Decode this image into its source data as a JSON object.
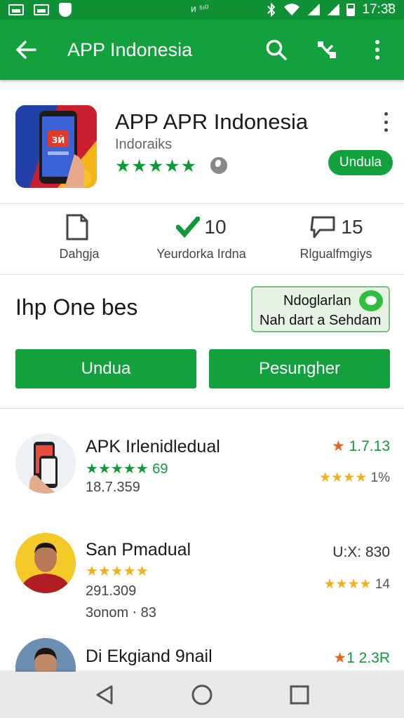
{
  "status_bar": {
    "center_text": "ᴎ ⁵ᶦ⁰",
    "time": "17:3̃8"
  },
  "app_bar": {
    "title": "APP Indonesia",
    "icons": [
      "back-arrow-icon",
      "search-icon",
      "share-icon",
      "more-vert-icon"
    ]
  },
  "app": {
    "name": "APP APR Indonesia",
    "developer": "Indoraiks",
    "stars": "★★★★★",
    "install_label": "Undula",
    "icon_badge": "ЗЙ"
  },
  "stats": [
    {
      "icon": "document-icon",
      "value": "",
      "label": "Dahgja"
    },
    {
      "icon": "check-icon",
      "value": "10",
      "label": "Yeurdorka Irdna"
    },
    {
      "icon": "comment-icon",
      "value": "15",
      "label": "Rlgualfmgiys"
    }
  ],
  "promo": {
    "title": "Ihp One bes",
    "card_line1": "Ndoglarlan",
    "card_line2": "Nah dart a Sehdam",
    "button_left": "Undua",
    "button_right": "Pesungher"
  },
  "list": [
    {
      "title": "APK Irlenidledual",
      "stars": "★★★★★",
      "stars_suffix": "69",
      "sub1": "18.7.359",
      "sub2": "",
      "right_value": "1.7.13",
      "right_value_star": "★",
      "right_stars": "★★★★",
      "right_stars_suffix": "1%"
    },
    {
      "title": "San Pmadual",
      "stars": "★★★★★",
      "stars_suffix": "",
      "sub1": "291.309",
      "sub2": "3onom ⋅ 83",
      "right_value": "U:X: 830",
      "right_value_star": "",
      "right_stars": "★★★★",
      "right_stars_suffix": "14"
    },
    {
      "title": "Di Ekgiand 9nail",
      "stars": "",
      "stars_suffix": "",
      "sub1": "",
      "sub2": "",
      "right_value": "1 2.3R",
      "right_value_star": "★",
      "right_stars": "★★★",
      "right_stars_suffix": "%"
    }
  ],
  "nav": [
    "back-triangle-icon",
    "home-circle-icon",
    "recents-square-icon"
  ],
  "colors": {
    "primary": "#12a13d",
    "status_bar": "#0f9135",
    "star_gold": "#f2b01e",
    "star_green": "#0f9a3a",
    "star_orange": "#e8641b"
  }
}
